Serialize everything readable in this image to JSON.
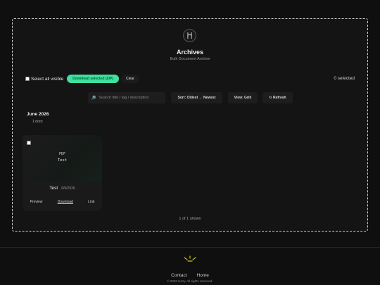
{
  "header": {
    "title": "Archives",
    "subtitle": "Bulk Document Archive"
  },
  "selection": {
    "select_all_label": "Select all visible",
    "download_label": "Download selected (ZIP)",
    "clear_label": "Clear",
    "selected_count": "0 selected"
  },
  "controls": {
    "search_placeholder": "Search title / tag / description",
    "sort_label": "Sort: Oldest → Newest",
    "view_label": "View: Grid",
    "refresh_label": "↻ Refresh"
  },
  "groups": [
    {
      "label": "June 2026",
      "count": "1 docs",
      "docs": [
        {
          "type": "PDF",
          "thumb_name": "Test",
          "name": "Test",
          "date": "6/9/2026",
          "actions": [
            "Preview",
            "Download",
            "Link"
          ]
        }
      ]
    }
  ],
  "status": {
    "shown": "1 of 1 shown"
  },
  "footer": {
    "links": [
      "Contact",
      "Home"
    ],
    "copyright": "© 2026 Hazy. All rights reserved."
  },
  "colors": {
    "accent": "#3fe0a0",
    "background": "#0f0f0f",
    "footer_logo": "#c8c800"
  },
  "icons": {
    "logo": "h-logo-icon",
    "search": "search-icon",
    "refresh": "refresh-icon"
  }
}
